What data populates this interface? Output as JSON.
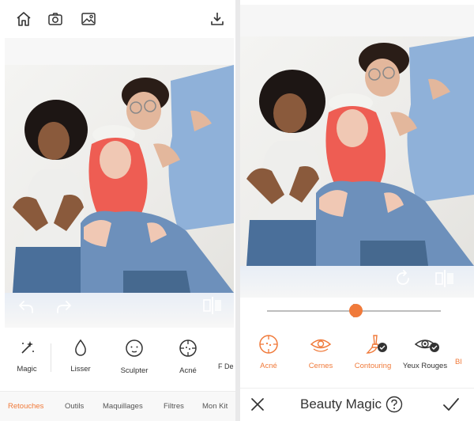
{
  "left_screen": {
    "toolbar": {
      "icons": [
        "home-icon",
        "camera-icon",
        "gallery-icon",
        "download-icon"
      ]
    },
    "tools": [
      {
        "label": "Magic",
        "icon": "magic-wand-icon"
      },
      {
        "label": "Lisser",
        "icon": "drop-icon"
      },
      {
        "label": "Sculpter",
        "icon": "face-icon"
      },
      {
        "label": "Acné",
        "icon": "acne-icon"
      },
      {
        "label": "F De",
        "icon": "partial-icon"
      }
    ],
    "tabs": [
      {
        "label": "Retouches",
        "active": true
      },
      {
        "label": "Outils",
        "active": false
      },
      {
        "label": "Maquillages",
        "active": false
      },
      {
        "label": "Filtres",
        "active": false
      },
      {
        "label": "Mon Kit",
        "active": false
      }
    ]
  },
  "right_screen": {
    "slider": {
      "value": 0.51
    },
    "tools": [
      {
        "label": "Acné",
        "icon": "acne-icon",
        "active": true
      },
      {
        "label": "Cernes",
        "icon": "eye-icon",
        "active": true
      },
      {
        "label": "Contouring",
        "icon": "brush-icon",
        "active": true,
        "checked": true
      },
      {
        "label": "Yeux Rouges",
        "icon": "red-eye-icon",
        "active": false,
        "checked": true
      },
      {
        "label": "Bl",
        "icon": "partial-icon",
        "active": true
      }
    ],
    "bottom_bar": {
      "title": "Beauty Magic",
      "cancel_icon": "close-icon",
      "help_icon": "help-icon",
      "confirm_icon": "check-icon"
    }
  },
  "colors": {
    "accent": "#f07a3a",
    "text": "#333333",
    "divider": "#e9e9ea"
  }
}
